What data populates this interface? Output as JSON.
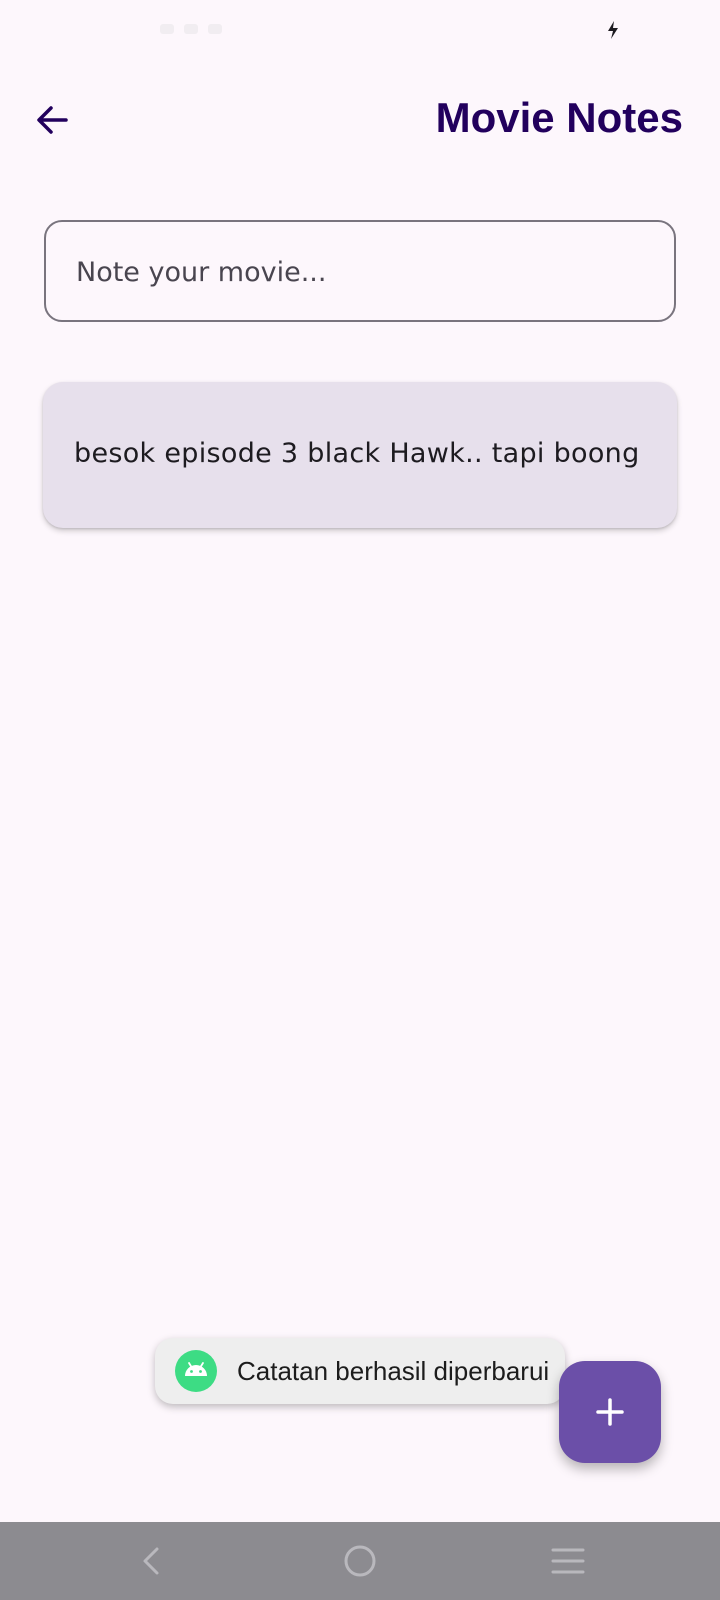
{
  "app": {
    "title": "Movie Notes"
  },
  "top_bar": {
    "back_icon": "arrow-back-icon"
  },
  "note_input": {
    "placeholder": "Note your movie...",
    "value": ""
  },
  "notes": [
    {
      "text": "besok episode 3 black Hawk.. tapi boong"
    }
  ],
  "toast": {
    "icon": "android-icon",
    "message": "Catatan berhasil diperbarui"
  },
  "fab": {
    "icon": "plus-icon"
  },
  "nav_bar": {
    "back_icon": "nav-back-icon",
    "home_icon": "nav-home-icon",
    "menu_icon": "nav-menu-icon"
  },
  "colors": {
    "background": "#FDF7FC",
    "title": "#22005D",
    "card": "#E7E0EC",
    "fab": "#6B4FA8",
    "toast_icon": "#3DDC84",
    "nav_bar": "#8C8B90"
  }
}
